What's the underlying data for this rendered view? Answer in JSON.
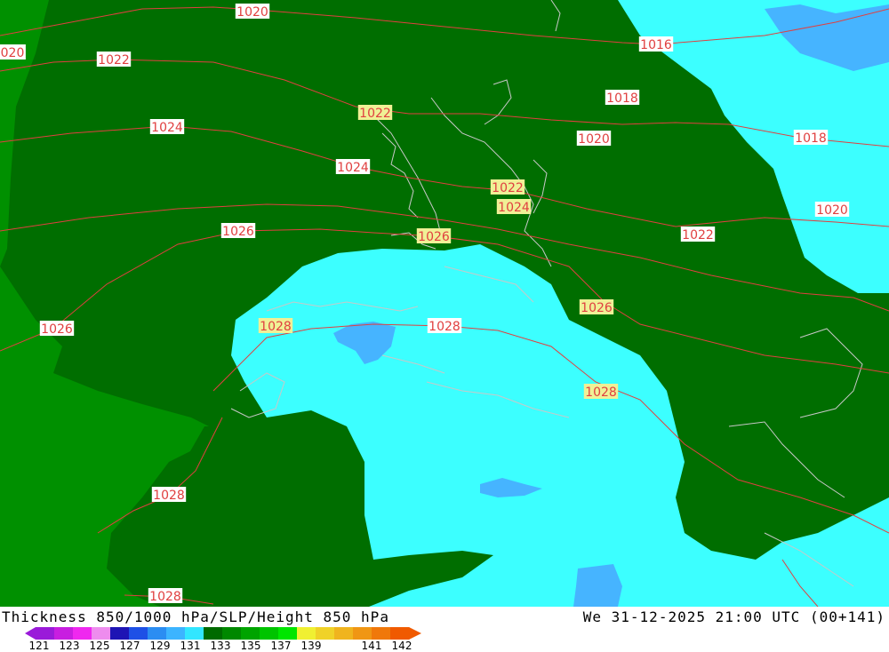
{
  "footer": {
    "title": "Thickness 850/1000 hPa/SLP/Height 850 hPa",
    "datetime": "We 31-12-2025 21:00 UTC (00+141)",
    "scale_colors": [
      "#9a1ad9",
      "#c81ee0",
      "#ef28ef",
      "#ee8cee",
      "#1e14b4",
      "#1e50e6",
      "#2b8df2",
      "#3cb4ff",
      "#32e6ff",
      "#006a00",
      "#008800",
      "#00a400",
      "#00c400",
      "#00e600",
      "#f0f032",
      "#f0d228",
      "#f0b41e",
      "#f09614",
      "#f0780a",
      "#f05a00"
    ],
    "scale_labels": [
      "121",
      "123",
      "125",
      "127",
      "129",
      "131",
      "133",
      "135",
      "137",
      "139",
      "141",
      "142"
    ]
  },
  "colors": {
    "dark_green": "#006e00",
    "mid_green": "#009000",
    "bright_green": "#00a000",
    "cyan": "#3cffff",
    "light_blue": "#46b4ff",
    "isobar": "#e04040",
    "coast": "#c0c0c0"
  },
  "isobar_labels": [
    {
      "text": "1020",
      "highlight": false
    },
    {
      "text": "020",
      "highlight": false
    },
    {
      "text": "1022",
      "highlight": false
    },
    {
      "text": "1016",
      "highlight": false
    },
    {
      "text": "1018",
      "highlight": false
    },
    {
      "text": "1022",
      "highlight": true
    },
    {
      "text": "1024",
      "highlight": false
    },
    {
      "text": "1020",
      "highlight": false
    },
    {
      "text": "1018",
      "highlight": false
    },
    {
      "text": "1024",
      "highlight": false
    },
    {
      "text": "1022",
      "highlight": true
    },
    {
      "text": "1024",
      "highlight": true
    },
    {
      "text": "1020",
      "highlight": false
    },
    {
      "text": "1026",
      "highlight": false
    },
    {
      "text": "1026",
      "highlight": true
    },
    {
      "text": "1022",
      "highlight": false
    },
    {
      "text": "1026",
      "highlight": true
    },
    {
      "text": "1028",
      "highlight": true
    },
    {
      "text": "1028",
      "highlight": false
    },
    {
      "text": "1026",
      "highlight": false
    },
    {
      "text": "1028",
      "highlight": true
    },
    {
      "text": "1028",
      "highlight": false
    },
    {
      "text": "1028",
      "highlight": false
    }
  ]
}
